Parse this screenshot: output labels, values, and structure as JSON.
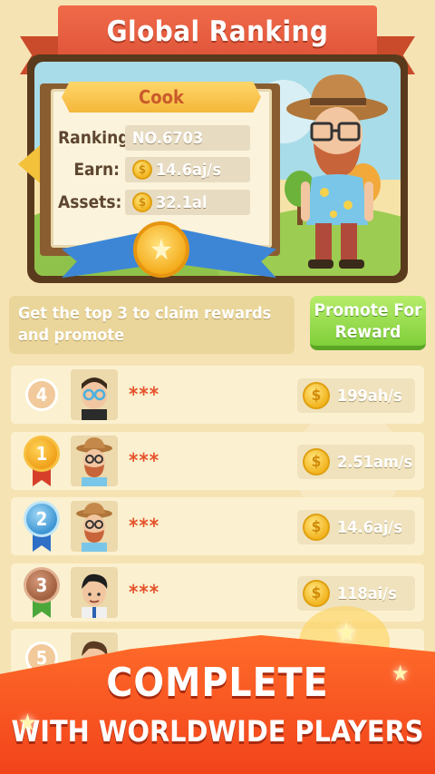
{
  "title": "Global Ranking",
  "profile": {
    "name": "Cook",
    "ranking_label": "Ranking:",
    "ranking_value": "NO.6703",
    "earn_label": "Earn:",
    "earn_value": "14.6aj/s",
    "assets_label": "Assets:",
    "assets_value": "32.1al"
  },
  "coin_symbol": "$",
  "reward_text": "Get the top 3 to claim rewards and promote",
  "promote_button": "Promote For Reward",
  "rows": [
    {
      "rank": "4",
      "name": "***",
      "income": "199ah/s",
      "medal": "none"
    },
    {
      "rank": "1",
      "name": "***",
      "income": "2.51am/s",
      "medal": "gold"
    },
    {
      "rank": "2",
      "name": "***",
      "income": "14.6aj/s",
      "medal": "silver"
    },
    {
      "rank": "3",
      "name": "***",
      "income": "118ai/s",
      "medal": "bronze"
    },
    {
      "rank": "5",
      "name": "",
      "income": "",
      "medal": "none"
    }
  ],
  "promo": {
    "line1": "COMPLETE",
    "line2": "WITH WORLDWIDE PLAYERS"
  },
  "colors": {
    "ribbon": "#e0553a",
    "accent_green": "#7fcf3a",
    "gold": "#f4a917",
    "silver": "#4aa3dd",
    "bronze": "#a8684a"
  }
}
